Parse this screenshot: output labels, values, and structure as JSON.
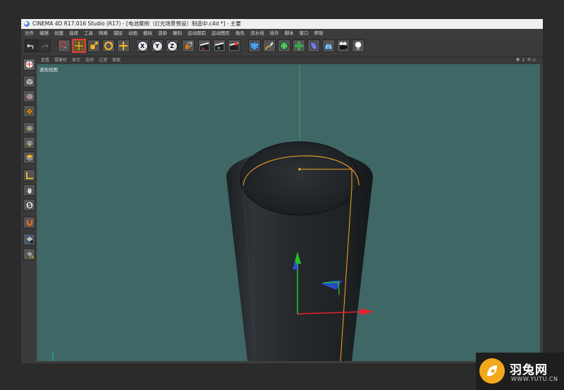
{
  "window": {
    "title": "CINEMA 4D R17.016 Studio (R17) - [电池案例（灯光场景预设）制造中.c4d *] - 主要"
  },
  "menubar": {
    "items": [
      "文件",
      "编辑",
      "创建",
      "选择",
      "工具",
      "网格",
      "捕捉",
      "动画",
      "模拟",
      "渲染",
      "雕刻",
      "运动跟踪",
      "运动图形",
      "角色",
      "流水线",
      "插件",
      "脚本",
      "窗口",
      "帮助"
    ]
  },
  "toolbar": {
    "axis_x": "X",
    "axis_y": "Y",
    "axis_z": "Z",
    "active_tool": "move"
  },
  "viewport": {
    "menus": [
      "查看",
      "摄像机",
      "显示",
      "选项",
      "过滤",
      "面板"
    ],
    "label": "透视视图",
    "nav_icons": "✥↓⟲▫"
  },
  "scene": {
    "object": "cylinder",
    "background_color": "#3e6766",
    "selection_color": "#f5a623",
    "axis_colors": {
      "x": "#e8222a",
      "y": "#22c22a",
      "z": "#2c4fe0"
    }
  },
  "watermark": {
    "name": "羽兔网",
    "url": "WWW.YUTU.CN"
  }
}
